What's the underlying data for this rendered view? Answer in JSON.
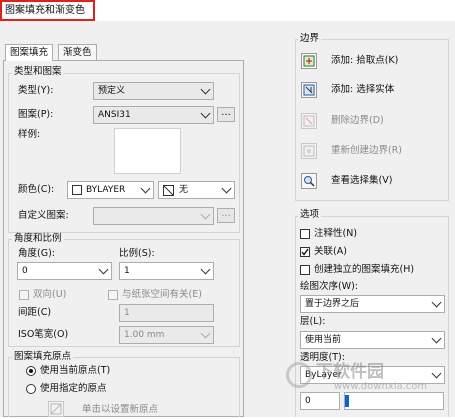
{
  "window": {
    "title": "图案填充和渐变色"
  },
  "tabs": [
    {
      "label": "图案填充",
      "active": true
    },
    {
      "label": "渐变色",
      "active": false
    }
  ],
  "type_pattern": {
    "group_title": "类型和图案",
    "type_label": "类型(Y):",
    "type_value": "预定义",
    "pattern_label": "图案(P):",
    "pattern_value": "ANSI31",
    "pattern_more": "...",
    "sample_label": "样例:",
    "color_label": "颜色(C):",
    "color_value": "BYLAYER",
    "bgcolor_value": "无",
    "custom_label": "自定义图案:",
    "custom_more": "..."
  },
  "angle_scale": {
    "group_title": "角度和比例",
    "angle_label": "角度(G):",
    "angle_value": "0",
    "scale_label": "比例(S):",
    "scale_value": "1",
    "double_label": "双向(U)",
    "relative_label": "与纸张空间有关(E)",
    "spacing_label": "间距(C)",
    "spacing_value": "1",
    "iso_label": "ISO笔宽(O)",
    "iso_value": "1.00 mm"
  },
  "origin": {
    "group_title": "图案填充原点",
    "current_label": "使用当前原点(T)",
    "specified_label": "使用指定的原点",
    "click_label": "单击以设置新原点"
  },
  "boundary": {
    "group_title": "边界",
    "pick_points": "添加: 拾取点(K)",
    "select_objects": "添加: 选择实体",
    "remove": "删除边界(D)",
    "recreate": "重新创建边界(R)",
    "view_selection": "查看选择集(V)"
  },
  "options": {
    "group_title": "选项",
    "annotative": "注释性(N)",
    "associative": "关联(A)",
    "separate": "创建独立的图案填充(H)",
    "draw_order_label": "绘图次序(W):",
    "draw_order_value": "置于边界之后",
    "layer_label": "层(L):",
    "layer_value": "使用当前",
    "transparency_label": "透明度(T):",
    "transparency_value": "ByLayer",
    "transparency_amount": "0"
  },
  "checkbox_states": {
    "annotative": false,
    "associative": true,
    "separate": false,
    "double": false,
    "relative": false
  },
  "watermark": {
    "cn": "下软件园",
    "en": "www.downxia.com"
  },
  "colors": {
    "title_border": "#e0201a",
    "selection_blue": "#0a64d6"
  }
}
